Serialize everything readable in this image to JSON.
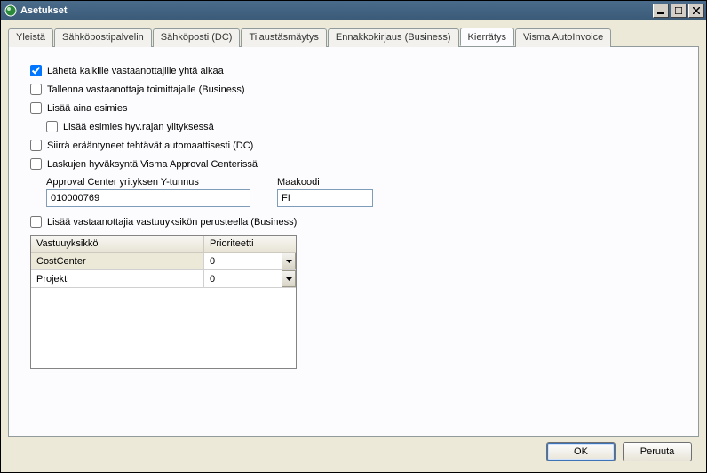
{
  "window": {
    "title": "Asetukset"
  },
  "tabs": [
    {
      "label": "Yleistä"
    },
    {
      "label": "Sähköpostipalvelin"
    },
    {
      "label": "Sähköposti (DC)"
    },
    {
      "label": "Tilaustäsmäytys"
    },
    {
      "label": "Ennakkokirjaus (Business)"
    },
    {
      "label": "Kierrätys"
    },
    {
      "label": "Visma AutoInvoice"
    }
  ],
  "checks": {
    "send_all": "Lähetä kaikille vastaanottajille yhtä aikaa",
    "save_recipient": "Tallenna vastaanottaja toimittajalle (Business)",
    "add_supervisor": "Lisää aina esimies",
    "add_supervisor_limit": "Lisää esimies hyv.rajan ylityksessä",
    "move_overdue": "Siirrä erääntyneet tehtävät automaattisesti (DC)",
    "approval_center": "Laskujen hyväksyntä Visma Approval Centerissä",
    "add_by_cost_unit": "Lisää vastaanottajia vastuuyksikön perusteella (Business)"
  },
  "fields": {
    "ytunnus_label": "Approval Center yrityksen Y-tunnus",
    "ytunnus_value": "010000769",
    "maakoodi_label": "Maakoodi",
    "maakoodi_value": "FI"
  },
  "grid": {
    "col1": "Vastuuyksikkö",
    "col2": "Prioriteetti",
    "rows": [
      {
        "name": "CostCenter",
        "priority": "0"
      },
      {
        "name": "Projekti",
        "priority": "0"
      }
    ]
  },
  "buttons": {
    "ok": "OK",
    "cancel": "Peruuta"
  }
}
